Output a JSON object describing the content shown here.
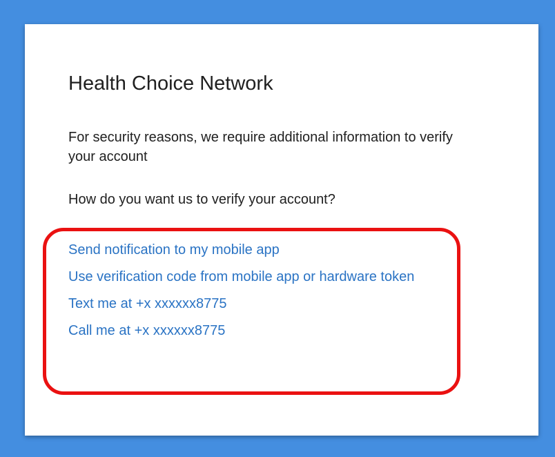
{
  "dialog": {
    "title": "Health Choice Network",
    "message": "For security reasons, we require additional information to verify your account",
    "question": "How do you want us to verify your account?",
    "options": [
      "Send notification to my mobile app",
      "Use verification code from mobile app or hardware token",
      "Text me at +x xxxxxx8775",
      "Call me at +x xxxxxx8775"
    ]
  },
  "colors": {
    "background": "#448ee0",
    "link": "#2a73c4",
    "highlight": "#ea1111"
  }
}
